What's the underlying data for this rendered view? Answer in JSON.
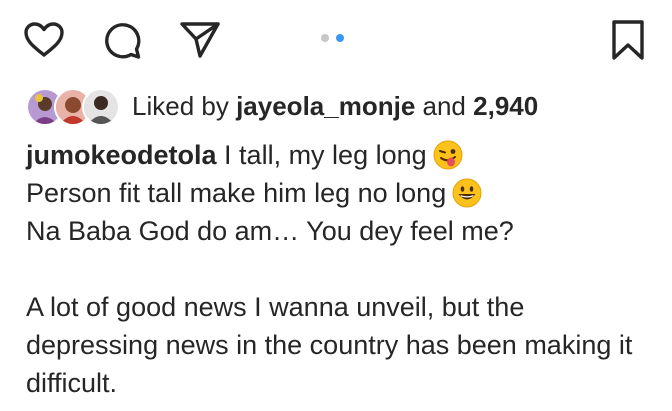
{
  "icons": {
    "like": "heart-outline-icon",
    "comment": "comment-bubble-icon",
    "share": "paper-plane-icon",
    "save": "bookmark-outline-icon"
  },
  "carousel": {
    "count": 2,
    "active_index": 1,
    "active_color": "#3897f0",
    "inactive_color": "#c7c7c7"
  },
  "likes": {
    "prefix": "Liked by",
    "user": "jayeola_monje",
    "connector": "and",
    "count": "2,940"
  },
  "caption": {
    "username": "jumokeodetola",
    "line1": "I tall, my leg long",
    "line1_emoji": "winking-face-with-tongue",
    "line2": "Person fit tall make him leg no long",
    "line2_emoji": "grinning-face",
    "line3": "Na Baba God do am… You dey feel me?",
    "paragraph2": "A lot of good news I wanna unveil, but the depressing news in the country has been making it difficult."
  }
}
